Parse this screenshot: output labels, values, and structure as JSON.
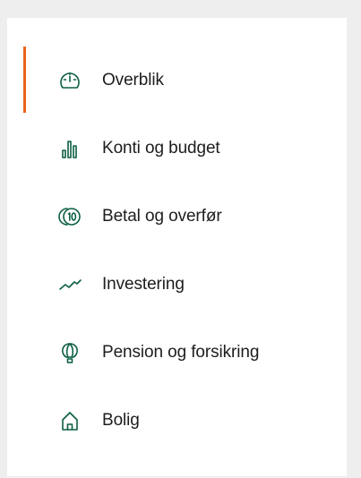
{
  "nav": {
    "items": [
      {
        "label": "Overblik",
        "icon": "speedometer-icon",
        "active": true
      },
      {
        "label": "Konti og budget",
        "icon": "bar-chart-icon",
        "active": false
      },
      {
        "label": "Betal og overfør",
        "icon": "coin-icon",
        "active": false
      },
      {
        "label": "Investering",
        "icon": "trend-line-icon",
        "active": false
      },
      {
        "label": "Pension og forsikring",
        "icon": "balloon-icon",
        "active": false
      },
      {
        "label": "Bolig",
        "icon": "house-icon",
        "active": false
      }
    ]
  },
  "colors": {
    "accent": "#e8641e",
    "icon": "#0b5e44",
    "text": "#1d1d1d",
    "panel": "#ffffff",
    "background": "#eeeeee"
  }
}
